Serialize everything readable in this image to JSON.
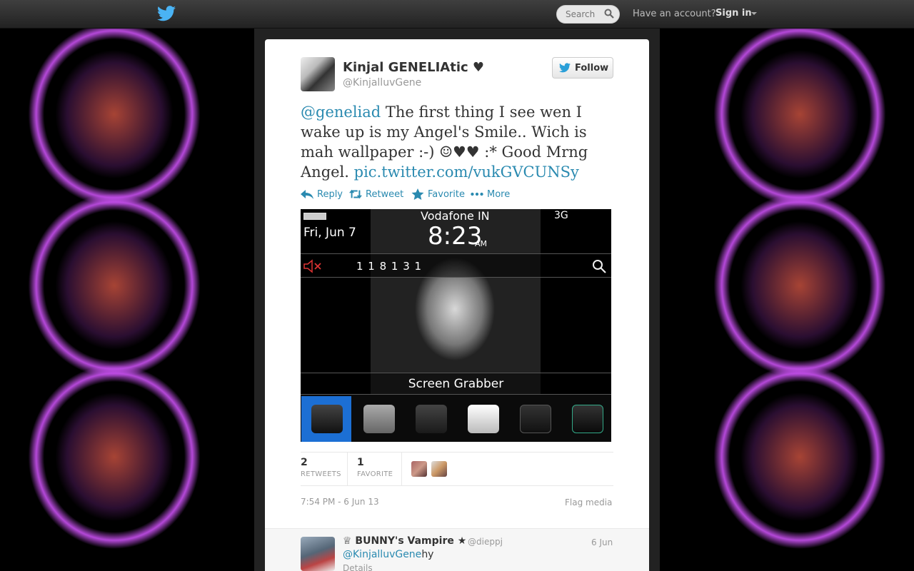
{
  "topbar": {
    "logo_icon": "twitter-bird-icon",
    "search_placeholder": "Search",
    "search_icon": "search-icon",
    "have_account": "Have an account?",
    "sign_in": "Sign in"
  },
  "tweet": {
    "display_name": "Kinjal GENELIAtic ♥",
    "handle": "@KinjalluvGene",
    "follow_label": "Follow",
    "mention": "@geneliad",
    "body": " The first thing I see wen I wake up is my Angel's Smile.. Wich is mah wallpaper :-) ☺♥♥ :* Good Mrng Angel. ",
    "pic_link": "pic.twitter.com/vukGVCUNSy",
    "actions": {
      "reply": "Reply",
      "retweet": "Retweet",
      "favorite": "Favorite",
      "more": "More"
    },
    "media": {
      "date": "Fri, Jun 7",
      "carrier": "Vodafone IN",
      "time": "8:23",
      "ampm": "AM",
      "signal": "3G",
      "notifications": "1   1   8     1   3   1",
      "caption": "Screen Grabber"
    },
    "stats": {
      "retweets_count": "2",
      "retweets_label": "RETWEETS",
      "favorites_count": "1",
      "favorites_label": "FAVORITE"
    },
    "timestamp": "7:54 PM - 6 Jun 13",
    "flag_media": "Flag media"
  },
  "reply": {
    "name": "♕ BUNNY's Vampire ★",
    "handle": "@dieppj",
    "date": "6 Jun",
    "mention": "@KinjalluvGene",
    "text": "hy",
    "details": "Details"
  },
  "colors": {
    "link": "#2a8ab0",
    "topbar": "#2b2b2b",
    "card": "#ffffff"
  }
}
